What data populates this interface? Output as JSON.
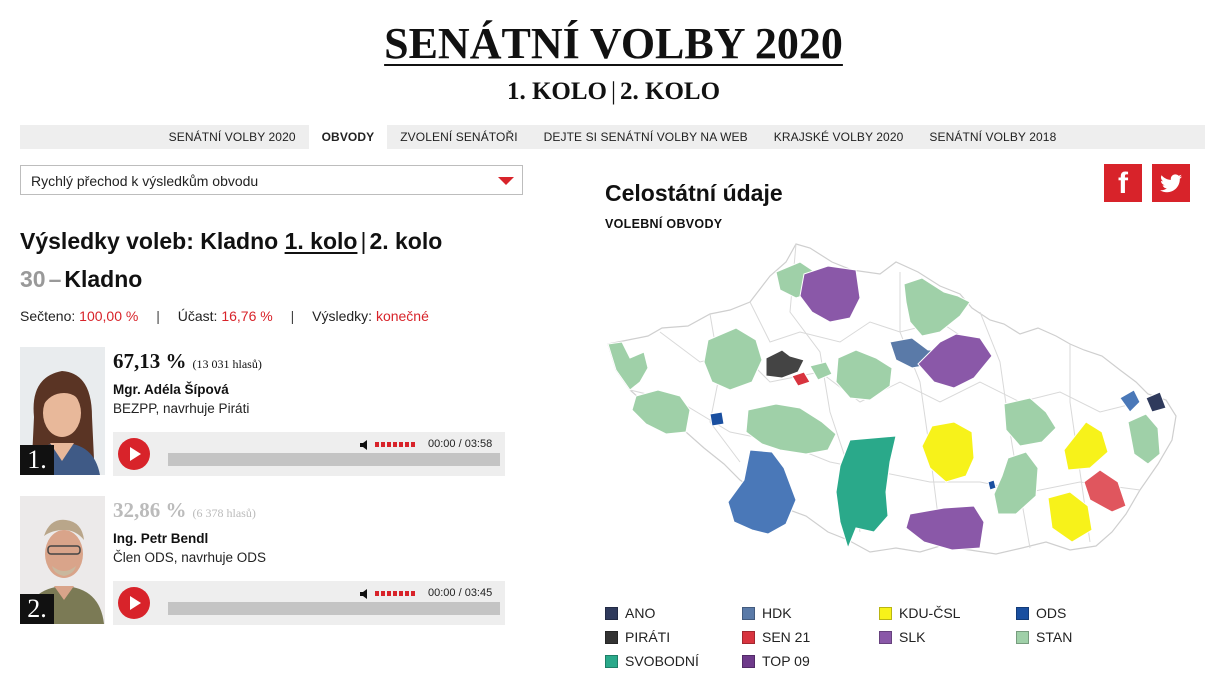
{
  "header": {
    "title": "SENÁTNÍ VOLBY 2020",
    "round1": "1. KOLO",
    "separator": "|",
    "round2": "2. KOLO"
  },
  "nav": {
    "items": [
      "SENÁTNÍ VOLBY 2020",
      "OBVODY",
      "ZVOLENÍ SENÁTOŘI",
      "DEJTE SI SENÁTNÍ VOLBY NA WEB",
      "KRAJSKÉ VOLBY 2020",
      "SENÁTNÍ VOLBY 2018"
    ],
    "active": "OBVODY"
  },
  "quick_select": {
    "label": "Rychlý přechod k výsledkům obvodu"
  },
  "results": {
    "title_prefix": "Výsledky voleb: Kladno",
    "round1": "1. kolo",
    "separator": "|",
    "round2": "2. kolo",
    "district_number": "30",
    "district_dash": "–",
    "district_name": "Kladno"
  },
  "stats": {
    "counted_label": "Sečteno:",
    "counted_value": "100,00 %",
    "turnout_label": "Účast:",
    "turnout_value": "16,76 %",
    "results_label": "Výsledky:",
    "results_value": "konečné",
    "separator": "|"
  },
  "candidates": [
    {
      "rank": "1.",
      "percent": "67,13 %",
      "votes": "(13 031 hlasů)",
      "name": "Mgr. Adéla Šípová",
      "affiliation": "BEZPP, navrhuje Piráti",
      "time": "00:00 / 03:58",
      "progress": 0
    },
    {
      "rank": "2.",
      "percent": "32,86 %",
      "votes": "(6 378 hlasů)",
      "name": "Ing. Petr Bendl",
      "affiliation": "Člen ODS, navrhuje ODS",
      "time": "00:00 / 03:45",
      "progress": 0
    }
  ],
  "national": {
    "title": "Celostátní údaje",
    "subtitle": "VOLEBNÍ OBVODY"
  },
  "share": {
    "facebook_icon": "f",
    "twitter_icon": "twitter-bird-icon"
  },
  "legend": [
    {
      "label": "ANO",
      "color": "#2f3a5c"
    },
    {
      "label": "HDK",
      "color": "#5a7aa8"
    },
    {
      "label": "KDU-ČSL",
      "color": "#f7f21a"
    },
    {
      "label": "ODS",
      "color": "#1a4fa0"
    },
    {
      "label": "PIRÁTI",
      "color": "#333333"
    },
    {
      "label": "SEN 21",
      "color": "#d8343f"
    },
    {
      "label": "SLK",
      "color": "#8a58a8"
    },
    {
      "label": "STAN",
      "color": "#9fd0a8"
    },
    {
      "label": "SVOBODNÍ",
      "color": "#2aa98a"
    },
    {
      "label": "TOP 09",
      "color": "#6e3a8a"
    }
  ]
}
